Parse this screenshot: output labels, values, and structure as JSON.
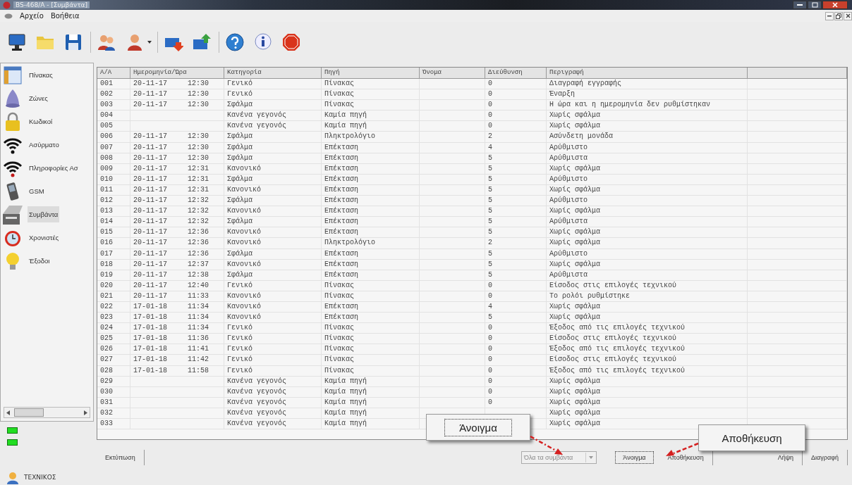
{
  "window": {
    "title": "BS-468/A - [Συμβάντα]"
  },
  "menu": [
    "Αρχείο",
    "Βοήθεια"
  ],
  "sidebar": {
    "items": [
      {
        "label": "Πίνακας",
        "selected": false
      },
      {
        "label": "Ζώνες",
        "selected": false
      },
      {
        "label": "Κωδικοί",
        "selected": false
      },
      {
        "label": "Ασύρματο",
        "selected": false
      },
      {
        "label": "Πληροφορίες Ασ",
        "selected": false
      },
      {
        "label": "GSM",
        "selected": false
      },
      {
        "label": "Συμβάντα",
        "selected": true
      },
      {
        "label": "Χρονιστές",
        "selected": false
      },
      {
        "label": "Έξοδοι",
        "selected": false
      }
    ]
  },
  "table": {
    "columns": [
      "Α/Α",
      "Ημερομηνία/Ώρα",
      "Κατηγορία",
      "Πηγή",
      "Όνομα",
      "Διεύθυνση",
      "Περιγραφή"
    ],
    "rows": [
      {
        "no": "001",
        "datetime": "20-11-17 12:30",
        "category": "Γενικό",
        "source": "Πίνακας",
        "address": "0",
        "description": "Διαγραφή εγγραφής"
      },
      {
        "no": "002",
        "datetime": "20-11-17 12:30",
        "category": "Γενικό",
        "source": "Πίνακας",
        "address": "0",
        "description": "Έναρξη"
      },
      {
        "no": "003",
        "datetime": "20-11-17 12:30",
        "category": "Σφάλμα",
        "source": "Πίνακας",
        "address": "0",
        "description": "Η ώρα και η ημερομηνία δεν ρυθμίστηκαν"
      },
      {
        "no": "004",
        "category": "Κανένα γεγονός",
        "source": "Καμία πηγή",
        "address": "0",
        "description": "Χωρίς σφάλμα"
      },
      {
        "no": "005",
        "category": "Κανένα γεγονός",
        "source": "Καμία πηγή",
        "address": "0",
        "description": "Χωρίς σφάλμα"
      },
      {
        "no": "006",
        "datetime": "20-11-17 12:30",
        "category": "Σφάλμα",
        "source": "Πληκτρολόγιο",
        "address": "2",
        "description": "Ασύνδετη μονάδα"
      },
      {
        "no": "007",
        "datetime": "20-11-17 12:30",
        "category": "Σφάλμα",
        "source": "Επέκταση",
        "address": "4",
        "description": "Αρύθμιστο"
      },
      {
        "no": "008",
        "datetime": "20-11-17 12:30",
        "category": "Σφάλμα",
        "source": "Επέκταση",
        "address": "5",
        "description": "Αρύθμιστα"
      },
      {
        "no": "009",
        "datetime": "20-11-17 12:31",
        "category": "Κανονικό",
        "source": "Επέκταση",
        "address": "5",
        "description": "Χωρίς σφάλμα"
      },
      {
        "no": "010",
        "datetime": "20-11-17 12:31",
        "category": "Σφάλμα",
        "source": "Επέκταση",
        "address": "5",
        "description": "Αρύθμιστο"
      },
      {
        "no": "011",
        "datetime": "20-11-17 12:31",
        "category": "Κανονικό",
        "source": "Επέκταση",
        "address": "5",
        "description": "Χωρίς σφάλμα"
      },
      {
        "no": "012",
        "datetime": "20-11-17 12:32",
        "category": "Σφάλμα",
        "source": "Επέκταση",
        "address": "5",
        "description": "Αρύθμιστο"
      },
      {
        "no": "013",
        "datetime": "20-11-17 12:32",
        "category": "Κανονικό",
        "source": "Επέκταση",
        "address": "5",
        "description": "Χωρίς σφάλμα"
      },
      {
        "no": "014",
        "datetime": "20-11-17 12:32",
        "category": "Σφάλμα",
        "source": "Επέκταση",
        "address": "5",
        "description": "Αρύθμιστα"
      },
      {
        "no": "015",
        "datetime": "20-11-17 12:36",
        "category": "Κανονικό",
        "source": "Επέκταση",
        "address": "5",
        "description": "Χωρίς σφάλμα"
      },
      {
        "no": "016",
        "datetime": "20-11-17 12:36",
        "category": "Κανονικό",
        "source": "Πληκτρολόγιο",
        "address": "2",
        "description": "Χωρίς σφάλμα"
      },
      {
        "no": "017",
        "datetime": "20-11-17 12:36",
        "category": "Σφάλμα",
        "source": "Επέκταση",
        "address": "5",
        "description": "Αρύθμιστο"
      },
      {
        "no": "018",
        "datetime": "20-11-17 12:37",
        "category": "Κανονικό",
        "source": "Επέκταση",
        "address": "5",
        "description": "Χωρίς σφάλμα"
      },
      {
        "no": "019",
        "datetime": "20-11-17 12:38",
        "category": "Σφάλμα",
        "source": "Επέκταση",
        "address": "5",
        "description": "Αρύθμιστα"
      },
      {
        "no": "020",
        "datetime": "20-11-17 12:40",
        "category": "Γενικό",
        "source": "Πίνακας",
        "address": "0",
        "description": "Είσοδος στις επιλογές τεχνικού"
      },
      {
        "no": "021",
        "datetime": "20-11-17 11:33",
        "category": "Κανονικό",
        "source": "Πίνακας",
        "address": "0",
        "description": "Το ρολόι ρυθμίστηκε"
      },
      {
        "no": "022",
        "datetime": "17-01-18 11:34",
        "category": "Κανονικό",
        "source": "Επέκταση",
        "address": "4",
        "description": "Χωρίς σφάλμα"
      },
      {
        "no": "023",
        "datetime": "17-01-18 11:34",
        "category": "Κανονικό",
        "source": "Επέκταση",
        "address": "5",
        "description": "Χωρίς σφάλμα"
      },
      {
        "no": "024",
        "datetime": "17-01-18 11:34",
        "category": "Γενικό",
        "source": "Πίνακας",
        "address": "0",
        "description": "Έξοδος από τις επιλογές τεχνικού"
      },
      {
        "no": "025",
        "datetime": "17-01-18 11:36",
        "category": "Γενικό",
        "source": "Πίνακας",
        "address": "0",
        "description": "Είσοδος στις επιλογές τεχνικού"
      },
      {
        "no": "026",
        "datetime": "17-01-18 11:41",
        "category": "Γενικό",
        "source": "Πίνακας",
        "address": "0",
        "description": "Έξοδος από τις επιλογές τεχνικού"
      },
      {
        "no": "027",
        "datetime": "17-01-18 11:42",
        "category": "Γενικό",
        "source": "Πίνακας",
        "address": "0",
        "description": "Είσοδος στις επιλογές τεχνικού"
      },
      {
        "no": "028",
        "datetime": "17-01-18 11:58",
        "category": "Γενικό",
        "source": "Πίνακας",
        "address": "0",
        "description": "Έξοδος από τις επιλογές τεχνικού"
      },
      {
        "no": "029",
        "category": "Κανένα γεγονός",
        "source": "Καμία πηγή",
        "address": "0",
        "description": "Χωρίς σφάλμα"
      },
      {
        "no": "030",
        "category": "Κανένα γεγονός",
        "source": "Καμία πηγή",
        "address": "0",
        "description": "Χωρίς σφάλμα"
      },
      {
        "no": "031",
        "category": "Κανένα γεγονός",
        "source": "Καμία πηγή",
        "address": "0",
        "description": "Χωρίς σφάλμα"
      },
      {
        "no": "032",
        "category": "Κανένα γεγονός",
        "source": "Καμία πηγή",
        "description": "Χωρίς σφάλμα"
      },
      {
        "no": "033",
        "category": "Κανένα γεγονός",
        "source": "Καμία πηγή",
        "description": "Χωρίς σφάλμα"
      }
    ]
  },
  "buttons": {
    "print": "Εκτύπωση",
    "filter": {
      "value": "Όλα τα συμβάντα",
      "disabled": true
    },
    "open": "Άνοιγμα",
    "save": "Αποθήκευση",
    "download": "Λήψη",
    "delete": "Διαγραφή"
  },
  "callouts": [
    "Άνοιγμα",
    "Αποθήκευση"
  ],
  "status_bar": {
    "user": "ΤΕΧΝΙΚΟΣ"
  }
}
